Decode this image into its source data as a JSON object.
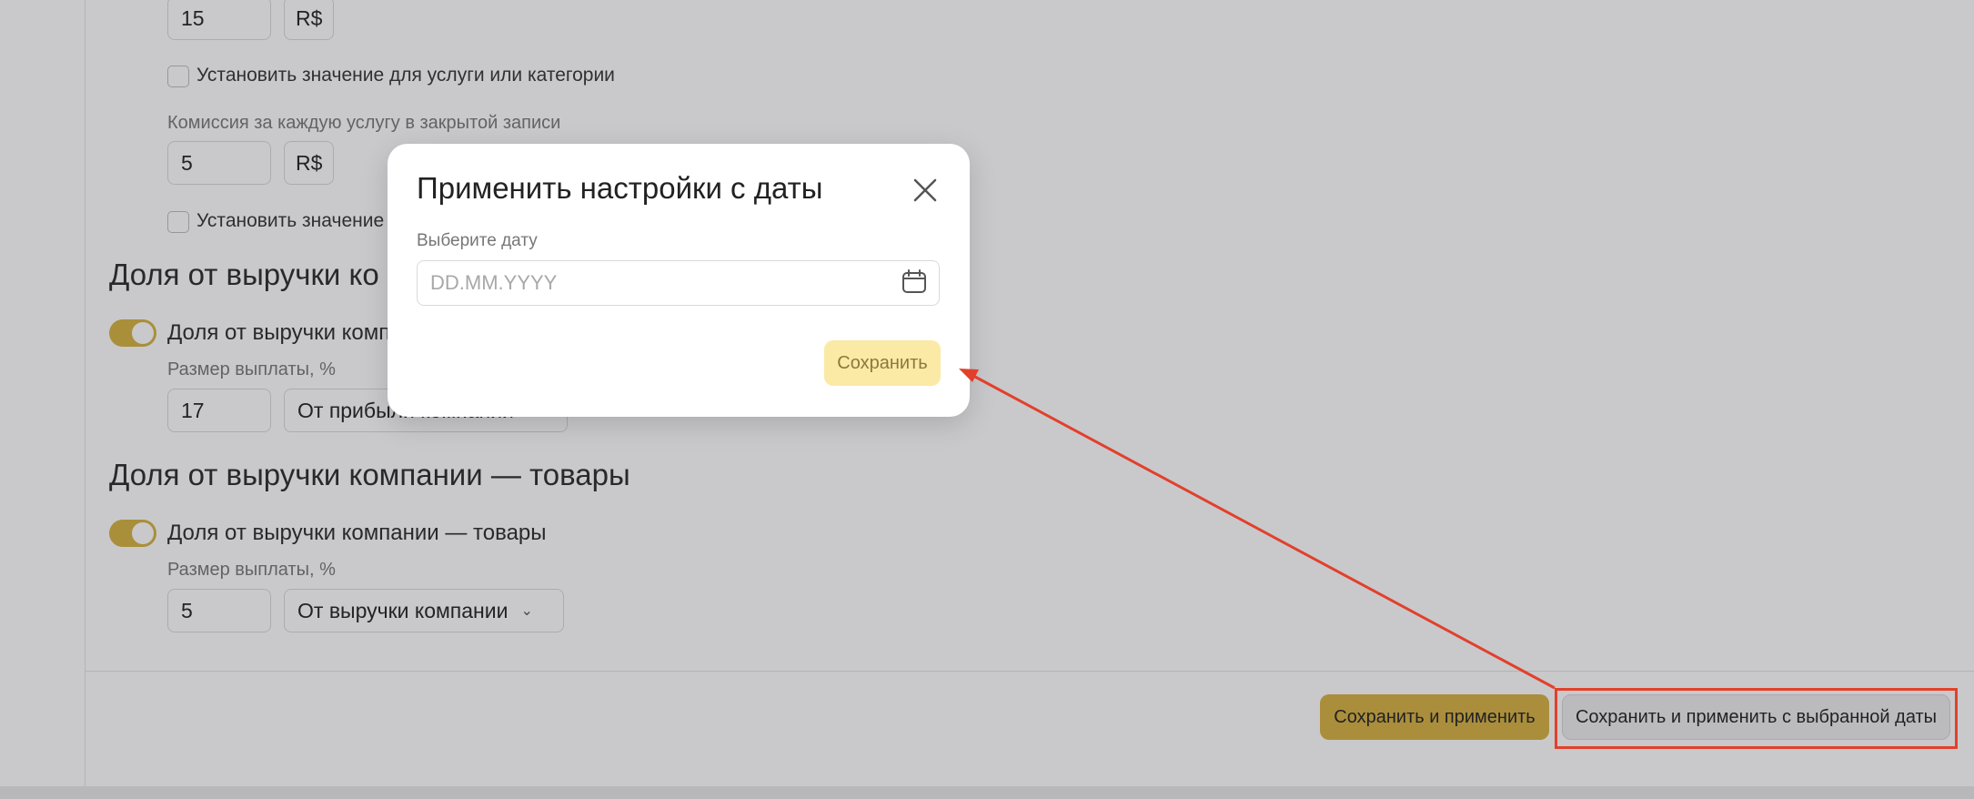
{
  "form": {
    "top_value": "15",
    "top_unit": "R$",
    "checkbox1_label": "Установить значение для услуги или категории",
    "commission_label": "Комиссия за каждую услугу в закрытой записи",
    "commission_value": "5",
    "commission_unit": "R$",
    "checkbox2_label": "Установить значение д",
    "section1_title": "Доля от выручки ко",
    "section1_toggle_label": "Доля от выручки комп",
    "section1_payout_label": "Размер выплаты, %",
    "section1_value": "17",
    "section1_select": "От прибыли компании",
    "section2_title": "Доля от выручки компании — товары",
    "section2_toggle_label": "Доля от выручки компании — товары",
    "section2_payout_label": "Размер выплаты, %",
    "section2_value": "5",
    "section2_select": "От выручки компании"
  },
  "footer": {
    "save_apply_label": "Сохранить и применить",
    "save_apply_date_label": "Сохранить и применить с выбранной даты"
  },
  "modal": {
    "title": "Применить настройки с даты",
    "date_label": "Выберите дату",
    "date_placeholder": "DD.MM.YYYY",
    "save_label": "Сохранить"
  },
  "colors": {
    "accent": "#d6b03e",
    "annotation": "#e2402b"
  }
}
